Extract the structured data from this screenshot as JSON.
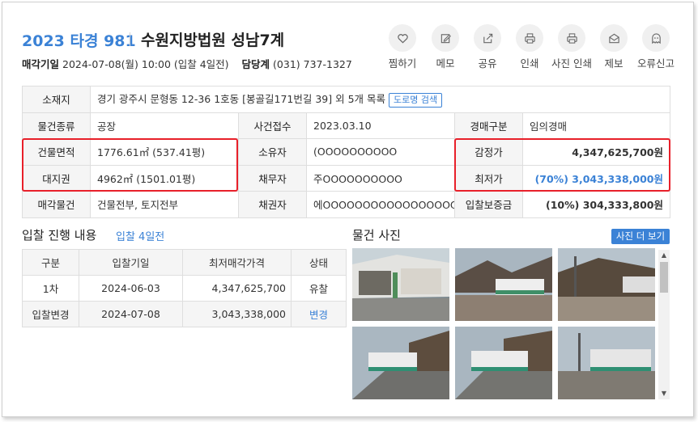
{
  "header": {
    "case_no": "2023 타경 981",
    "court": "수원지방법원 성남7계",
    "sale_date_label": "매각기일",
    "sale_date_value": "2024-07-08(월) 10:00 (입찰 4일전)",
    "manager_label": "담당계",
    "manager_value": "(031) 737-1327"
  },
  "actions": [
    {
      "label": "찜하기",
      "icon": "heart-icon"
    },
    {
      "label": "메모",
      "icon": "pencil-icon"
    },
    {
      "label": "공유",
      "icon": "share-icon"
    },
    {
      "label": "인쇄",
      "icon": "printer-icon"
    },
    {
      "label": "사진 인쇄",
      "icon": "printer-icon"
    },
    {
      "label": "제보",
      "icon": "envelope-icon"
    },
    {
      "label": "오류신고",
      "icon": "ghost-icon"
    }
  ],
  "info": {
    "address_label": "소재지",
    "address_value": "경기 광주시 문형동 12-36 1호동 [봉골길171번길 39] 외 5개 목록",
    "road_search": "도로명 검색",
    "type_label": "물건종류",
    "type_value": "공장",
    "receipt_label": "사건접수",
    "receipt_value": "2023.03.10",
    "auction_type_label": "경매구분",
    "auction_type_value": "임의경매",
    "building_area_label": "건물면적",
    "building_area_value": "1776.61㎡ (537.41평)",
    "owner_label": "소유자",
    "owner_value": "(OOOOOOOOOO",
    "appraisal_label": "감정가",
    "appraisal_value": "4,347,625,700원",
    "land_label": "대지권",
    "land_value": "4962㎡ (1501.01평)",
    "debtor_label": "채무자",
    "debtor_value": "주OOOOOOOOOO",
    "min_price_label": "최저가",
    "min_price_value": "(70%) 3,043,338,000원",
    "sale_items_label": "매각물건",
    "sale_items_value": "건물전부, 토지전부",
    "creditor_label": "채권자",
    "creditor_value": "에OOOOOOOOOOOOOOOOO",
    "deposit_label": "입찰보증금",
    "deposit_value": "(10%) 304,333,800원"
  },
  "bids": {
    "title": "입찰 진행 내용",
    "subtitle": "입찰 4일전",
    "headers": [
      "구분",
      "입찰기일",
      "최저매각가격",
      "상태"
    ],
    "rows": [
      [
        "1차",
        "2024-06-03",
        "4,347,625,700",
        "유찰"
      ],
      [
        "입찰변경",
        "2024-07-08",
        "3,043,338,000",
        "변경"
      ]
    ]
  },
  "photos": {
    "title": "물건 사진",
    "more_button": "사진 더 보기"
  },
  "colors": {
    "accent": "#3b82d6",
    "highlight": "#e8202a"
  }
}
